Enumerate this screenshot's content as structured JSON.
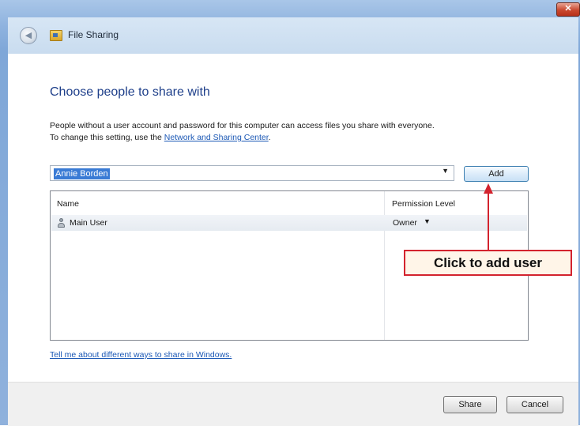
{
  "window": {
    "title": "File Sharing",
    "close_glyph": "✕"
  },
  "navigation": {
    "back_glyph": "◀"
  },
  "main": {
    "heading": "Choose people to share with",
    "description_line1": "People without a user account and password for this computer can access files you share with everyone.",
    "description_line2_prefix": "To change this setting, use the ",
    "description_link": "Network and Sharing Center",
    "description_line2_suffix": "."
  },
  "user_picker": {
    "value": "Annie Borden",
    "arrow_glyph": "▼",
    "add_label": "Add"
  },
  "sharing_list": {
    "columns": [
      "Name",
      "Permission Level"
    ],
    "rows": [
      {
        "name": "Main User",
        "permission": "Owner",
        "caret": "▼",
        "icon": "user-icon"
      }
    ]
  },
  "help_link": "Tell me about different ways to share in Windows.",
  "footer": {
    "share_label": "Share",
    "cancel_label": "Cancel"
  },
  "annotation": {
    "text": "Click to add user",
    "color": "#d3232e"
  },
  "colors": {
    "heading": "#1e3f8a",
    "link": "#1b58b5",
    "selection": "#3a7bd5",
    "frame": "#8fb1dc"
  }
}
